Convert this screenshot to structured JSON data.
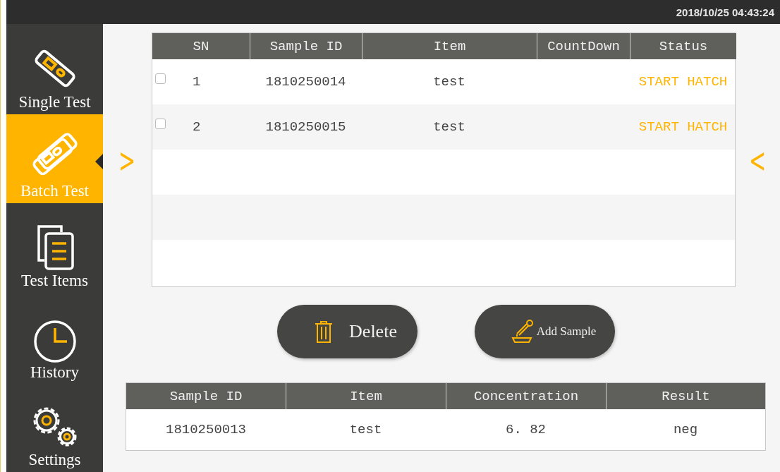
{
  "status_bar": {
    "datetime": "2018/10/25 04:43:24"
  },
  "sidebar": {
    "items": [
      {
        "label": "Single Test",
        "selected": false
      },
      {
        "label": "Batch Test",
        "selected": true
      },
      {
        "label": "Test Items",
        "selected": false
      },
      {
        "label": "History",
        "selected": false
      },
      {
        "label": "Settings",
        "selected": false
      }
    ]
  },
  "batch_table": {
    "columns": [
      "SN",
      "Sample ID",
      "Item",
      "CountDown",
      "Status"
    ],
    "rows": [
      {
        "checked": false,
        "sn": "1",
        "sample_id": "1810250014",
        "item": "test",
        "countdown": "",
        "status": "START HATCH"
      },
      {
        "checked": false,
        "sn": "2",
        "sample_id": "1810250015",
        "item": "test",
        "countdown": "",
        "status": "START HATCH"
      }
    ]
  },
  "nav": {
    "prev": ">",
    "next": "<"
  },
  "buttons": [
    {
      "kind": "delete",
      "label": "Delete"
    },
    {
      "kind": "add",
      "label": "Add Sample"
    }
  ],
  "result_table": {
    "columns": [
      "Sample ID",
      "Item",
      "Concentration",
      "Result"
    ],
    "rows": [
      {
        "sample_id": "1810250013",
        "item": "test",
        "concentration": "6. 82",
        "result": "neg"
      }
    ]
  }
}
